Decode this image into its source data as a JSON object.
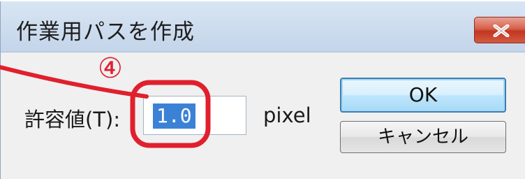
{
  "dialog": {
    "title": "作業用パスを作成"
  },
  "form": {
    "tolerance_label": "許容値(T):",
    "tolerance_value": "1.0",
    "unit": "pixel"
  },
  "buttons": {
    "ok": "OK",
    "cancel": "キャンセル"
  },
  "annotation": {
    "step_marker": "④",
    "color": "#e0202d"
  },
  "colors": {
    "close_button": "#c2361f",
    "selection": "#3b82d6",
    "default_button_border": "#3c7fb1"
  }
}
